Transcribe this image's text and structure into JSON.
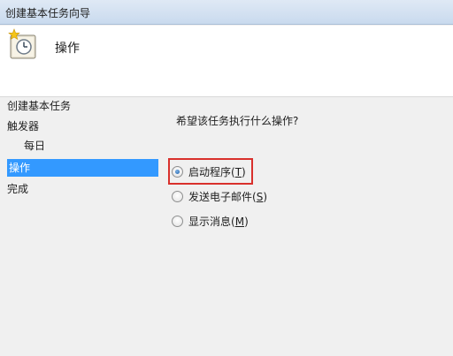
{
  "window": {
    "title": "创建基本任务向导"
  },
  "header": {
    "title": "操作",
    "icon": "task-clock-icon"
  },
  "nav": {
    "items": [
      {
        "label": "创建基本任务",
        "selected": false,
        "sub": false
      },
      {
        "label": "触发器",
        "selected": false,
        "sub": false
      },
      {
        "label": "每日",
        "selected": false,
        "sub": true
      },
      {
        "label": "操作",
        "selected": true,
        "sub": false
      },
      {
        "label": "完成",
        "selected": false,
        "sub": false
      }
    ]
  },
  "content": {
    "question": "希望该任务执行什么操作?",
    "options": [
      {
        "label": "启动程序",
        "key": "T",
        "checked": true
      },
      {
        "label": "发送电子邮件",
        "key": "S",
        "checked": false
      },
      {
        "label": "显示消息",
        "key": "M",
        "checked": false
      }
    ]
  },
  "colors": {
    "selection": "#3399ff",
    "highlight": "#d9302c"
  }
}
